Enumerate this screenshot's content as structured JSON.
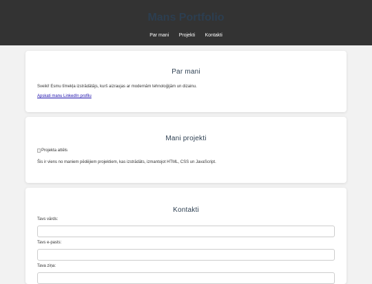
{
  "header": {
    "title": "Mans Portfolio",
    "nav": [
      {
        "label": "Par mani"
      },
      {
        "label": "Projekti"
      },
      {
        "label": "Kontakti"
      }
    ]
  },
  "about": {
    "heading": "Par mani",
    "bio": "Sveiki! Esmu tīmekļa izstrādātājs, kurš aizraujas ar modernām tehnoloģijām un dizainu.",
    "link_label": "Apskati manu LinkedIn profilu"
  },
  "projects": {
    "heading": "Mani projekti",
    "image_alt": "Projekta attēls",
    "description": "Šis ir viens no maniem pēdējiem projektiem, kas izstrādāts, izmantojot HTML, CSS un JavaScript."
  },
  "contact": {
    "heading": "Kontakti",
    "name_label": "Tavs vārds:",
    "name_value": "",
    "email_label": "Tavs e-pasts:",
    "email_value": "",
    "message_label": "Tava ziņa:",
    "message_value": ""
  },
  "colors": {
    "header_bg": "#333333",
    "heading": "#2c3e50",
    "link": "#1a0dab",
    "page_bg": "#f2f2f2"
  }
}
